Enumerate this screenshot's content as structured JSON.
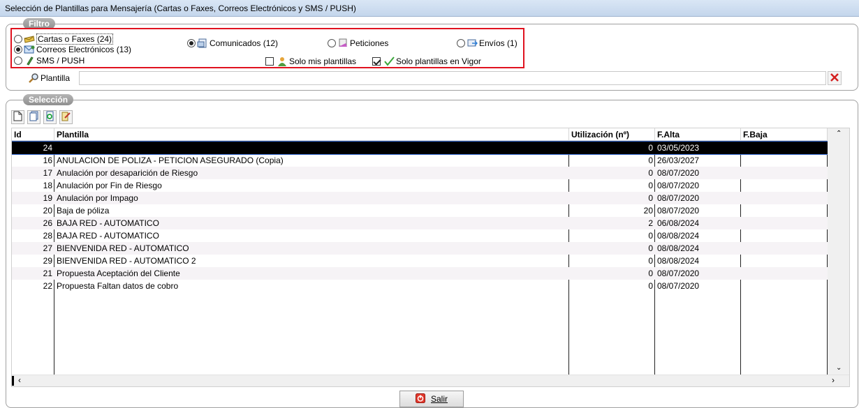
{
  "window": {
    "title": "Selección de Plantillas para Mensajería (Cartas o Faxes, Correos Electrónicos y SMS / PUSH)"
  },
  "filtro": {
    "label": "Filtro",
    "types": [
      {
        "label": "Cartas o Faxes (24)",
        "selected": false,
        "icon": "envelope-icon"
      },
      {
        "label": "Correos Electrónicos (13)",
        "selected": true,
        "icon": "email-icon"
      },
      {
        "label": "SMS / PUSH",
        "selected": false,
        "icon": "phone-icon"
      }
    ],
    "categories": [
      {
        "label": "Comunicados (12)",
        "selected": true,
        "icon": "document-icon"
      },
      {
        "label": "Peticiones",
        "selected": false,
        "icon": "request-icon"
      },
      {
        "label": "Envíos (1)",
        "selected": false,
        "icon": "send-icon"
      }
    ],
    "solo_mis_plantillas": {
      "label": "Solo mis plantillas",
      "checked": false
    },
    "solo_vigor": {
      "label": "Solo plantillas en Vigor",
      "checked": true
    },
    "plantilla": {
      "label": "Plantilla",
      "value": ""
    }
  },
  "seleccion": {
    "label": "Selección",
    "toolbar": [
      "new-document-icon",
      "copy-document-icon",
      "refresh-document-icon",
      "edit-document-icon"
    ],
    "columns": {
      "id": "Id",
      "plantilla": "Plantilla",
      "utilizacion": "Utilización (nº)",
      "falta": "F.Alta",
      "fbaja": "F.Baja"
    },
    "rows": [
      {
        "id": "24",
        "plantilla": "",
        "utilizacion": "0",
        "falta": "03/05/2023",
        "fbaja": ""
      },
      {
        "id": "16",
        "plantilla": "ANULACION DE POLIZA - PETICION ASEGURADO (Copia)",
        "utilizacion": "0",
        "falta": "26/03/2027",
        "fbaja": ""
      },
      {
        "id": "17",
        "plantilla": "Anulación por desaparición de Riesgo",
        "utilizacion": "0",
        "falta": "08/07/2020",
        "fbaja": ""
      },
      {
        "id": "18",
        "plantilla": "Anulación por Fin de Riesgo",
        "utilizacion": "0",
        "falta": "08/07/2020",
        "fbaja": ""
      },
      {
        "id": "19",
        "plantilla": "Anulación por Impago",
        "utilizacion": "0",
        "falta": "08/07/2020",
        "fbaja": ""
      },
      {
        "id": "20",
        "plantilla": "Baja de póliza",
        "utilizacion": "20",
        "falta": "08/07/2020",
        "fbaja": ""
      },
      {
        "id": "26",
        "plantilla": "BAJA RED - AUTOMATICO",
        "utilizacion": "2",
        "falta": "06/08/2024",
        "fbaja": ""
      },
      {
        "id": "28",
        "plantilla": "BAJA RED - AUTOMATICO",
        "utilizacion": "0",
        "falta": "08/08/2024",
        "fbaja": ""
      },
      {
        "id": "27",
        "plantilla": "BIENVENIDA RED - AUTOMATICO",
        "utilizacion": "0",
        "falta": "08/08/2024",
        "fbaja": ""
      },
      {
        "id": "29",
        "plantilla": "BIENVENIDA RED - AUTOMATICO 2",
        "utilizacion": "0",
        "falta": "08/08/2024",
        "fbaja": ""
      },
      {
        "id": "21",
        "plantilla": "Propuesta Aceptación del Cliente",
        "utilizacion": "0",
        "falta": "08/07/2020",
        "fbaja": ""
      },
      {
        "id": "22",
        "plantilla": "Propuesta Faltan datos de cobro",
        "utilizacion": "0",
        "falta": "08/07/2020",
        "fbaja": ""
      }
    ],
    "selected_row": 0
  },
  "footer": {
    "salir_label": "Salir"
  },
  "colors": {
    "highlight_border": "#e0121f",
    "selected_row_bg": "#000000",
    "titlebar": "#c4d6ec"
  }
}
